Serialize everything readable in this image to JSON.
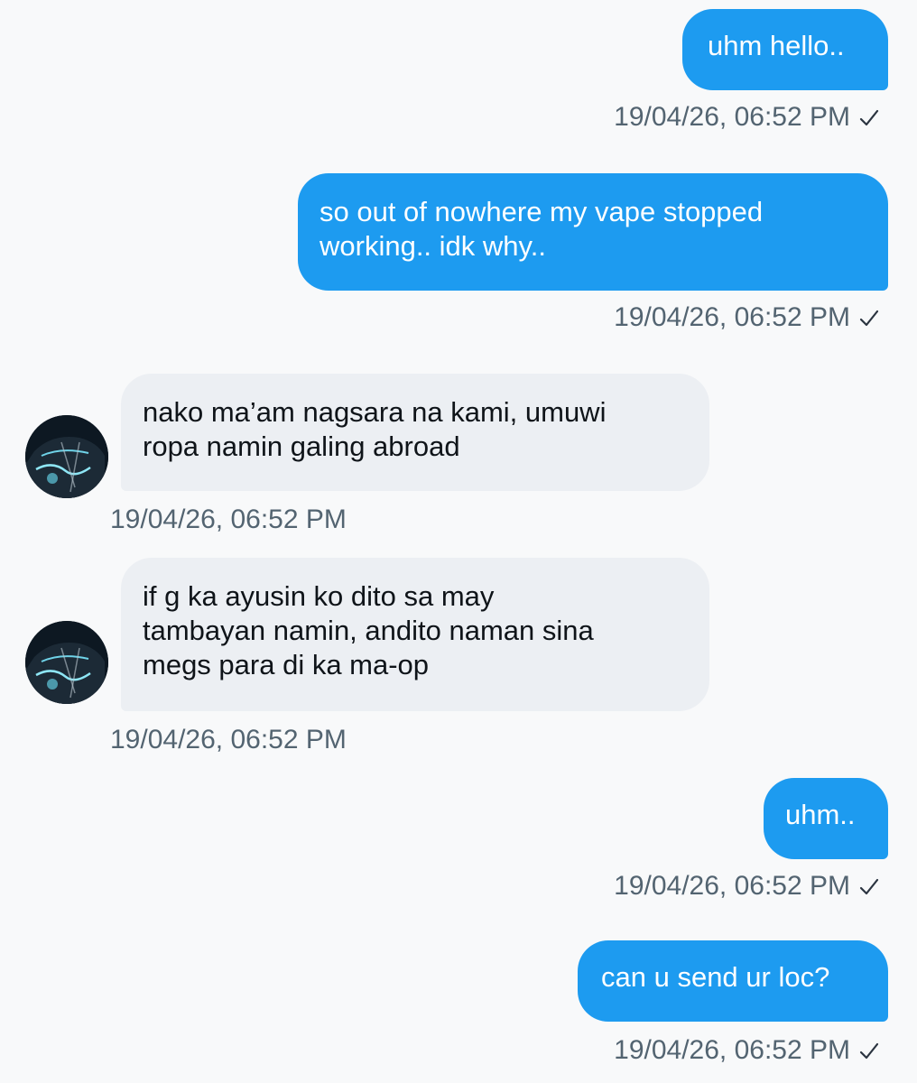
{
  "messages": [
    {
      "direction": "out",
      "text": "uhm hello..",
      "time": "19/04/26, 06:52 PM"
    },
    {
      "direction": "out",
      "text": "so out of nowhere my vape stopped\nworking.. idk why..",
      "time": "19/04/26, 06:52 PM"
    },
    {
      "direction": "in",
      "text": "nako ma’am nagsara na kami, umuwi\nropa namin galing abroad",
      "time": "19/04/26, 06:52 PM"
    },
    {
      "direction": "in",
      "text": "if g ka ayusin ko dito sa may\ntambayan namin, andito naman sina\nmegs para di ka ma-op",
      "time": "19/04/26, 06:52 PM"
    },
    {
      "direction": "out",
      "text": "uhm..",
      "time": "19/04/26, 06:52 PM"
    },
    {
      "direction": "out",
      "text": "can u send ur loc?",
      "time": "19/04/26, 06:52 PM"
    }
  ],
  "colors": {
    "outgoing_bubble": "#1d9bf0",
    "incoming_bubble": "#eceff3",
    "timestamp": "#536471"
  },
  "icons": {
    "sent_status": "check-icon",
    "contact_avatar": "avatar"
  }
}
